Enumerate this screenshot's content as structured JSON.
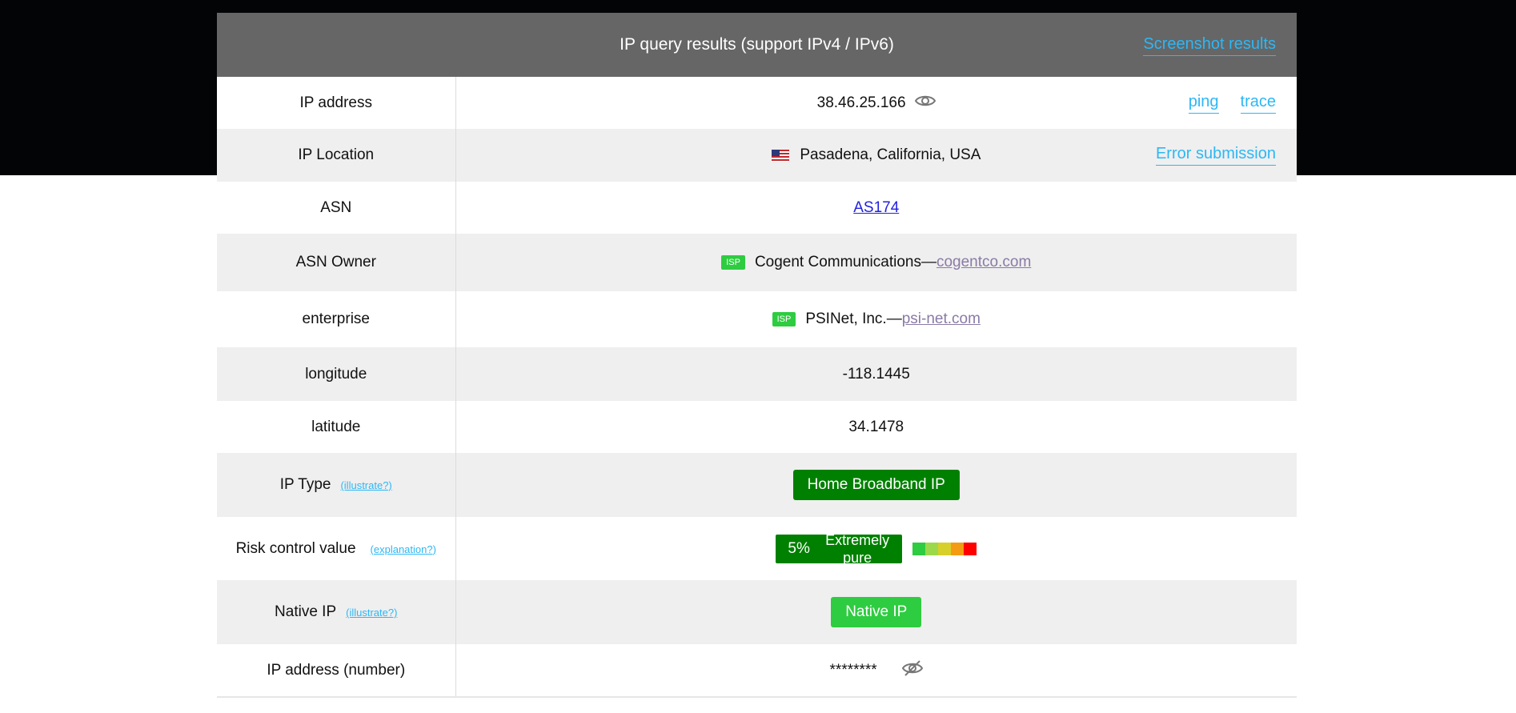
{
  "header": {
    "title": "IP query results (support IPv4 / IPv6)",
    "screenshot_link": "Screenshot results"
  },
  "rows": {
    "ip_address": {
      "label": "IP address",
      "value": "38.46.25.166",
      "ping": "ping",
      "trace": "trace",
      "icon": "eye-icon"
    },
    "ip_location": {
      "label": "IP Location",
      "value": "Pasadena, California, USA",
      "flag": "us-flag-icon",
      "error_link": "Error submission"
    },
    "asn": {
      "label": "ASN",
      "value": "AS174"
    },
    "asn_owner": {
      "label": "ASN Owner",
      "badge": "ISP",
      "name": "Cogent Communications—",
      "domain": "cogentco.com"
    },
    "enterprise": {
      "label": "enterprise",
      "badge": "ISP",
      "name": "PSINet, Inc.—",
      "domain": "psi-net.com"
    },
    "longitude": {
      "label": "longitude",
      "value": "-118.1445"
    },
    "latitude": {
      "label": "latitude",
      "value": "34.1478"
    },
    "ip_type": {
      "label": "IP Type",
      "help": "(illustrate?)",
      "value": "Home Broadband IP"
    },
    "risk": {
      "label": "Risk control value",
      "help": "(explanation?)",
      "percent": "5%",
      "level": "Extremely pure",
      "scale_colors": [
        "#2ecc40",
        "#9bd94a",
        "#d7d02a",
        "#f39c12",
        "#ff0000"
      ]
    },
    "native_ip": {
      "label": "Native IP",
      "help": "(illustrate?)",
      "value": "Native IP"
    },
    "ip_number": {
      "label": "IP address (number)",
      "value": "********",
      "icon": "eye-off-icon"
    }
  },
  "colors": {
    "header_bg": "#666666",
    "link": "#2db7f5",
    "green_dark": "#008000",
    "green_light": "#2ecc40",
    "row_alt": "#efefef"
  }
}
